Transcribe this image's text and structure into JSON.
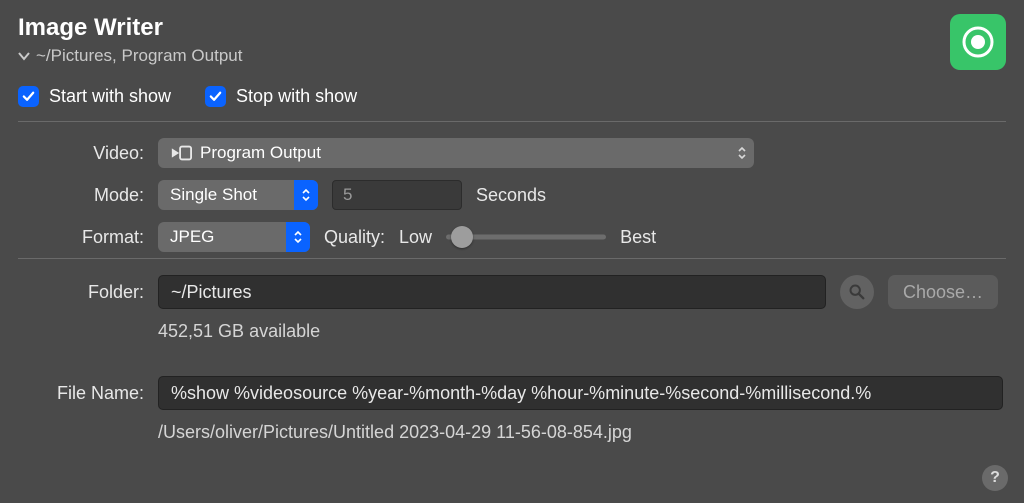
{
  "header": {
    "title": "Image Writer",
    "subtitle": "~/Pictures, Program Output"
  },
  "options": {
    "start_with_show": {
      "checked": true,
      "label": "Start with show"
    },
    "stop_with_show": {
      "checked": true,
      "label": "Stop with show"
    }
  },
  "video": {
    "label": "Video:",
    "value": "Program Output"
  },
  "mode": {
    "label": "Mode:",
    "value": "Single Shot",
    "interval_value": "5",
    "interval_unit": "Seconds"
  },
  "format": {
    "label": "Format:",
    "value": "JPEG",
    "quality_label": "Quality:",
    "quality_low": "Low",
    "quality_best": "Best",
    "quality_position_pct": 10
  },
  "folder": {
    "label": "Folder:",
    "value": "~/Pictures",
    "choose_label": "Choose…",
    "available": "452,51 GB available"
  },
  "file": {
    "label": "File Name:",
    "value": "%show %videosource %year-%month-%day %hour-%minute-%second-%millisecond.%",
    "resolved": "/Users/oliver/Pictures/Untitled 2023-04-29 11-56-08-854.jpg"
  },
  "help_glyph": "?"
}
